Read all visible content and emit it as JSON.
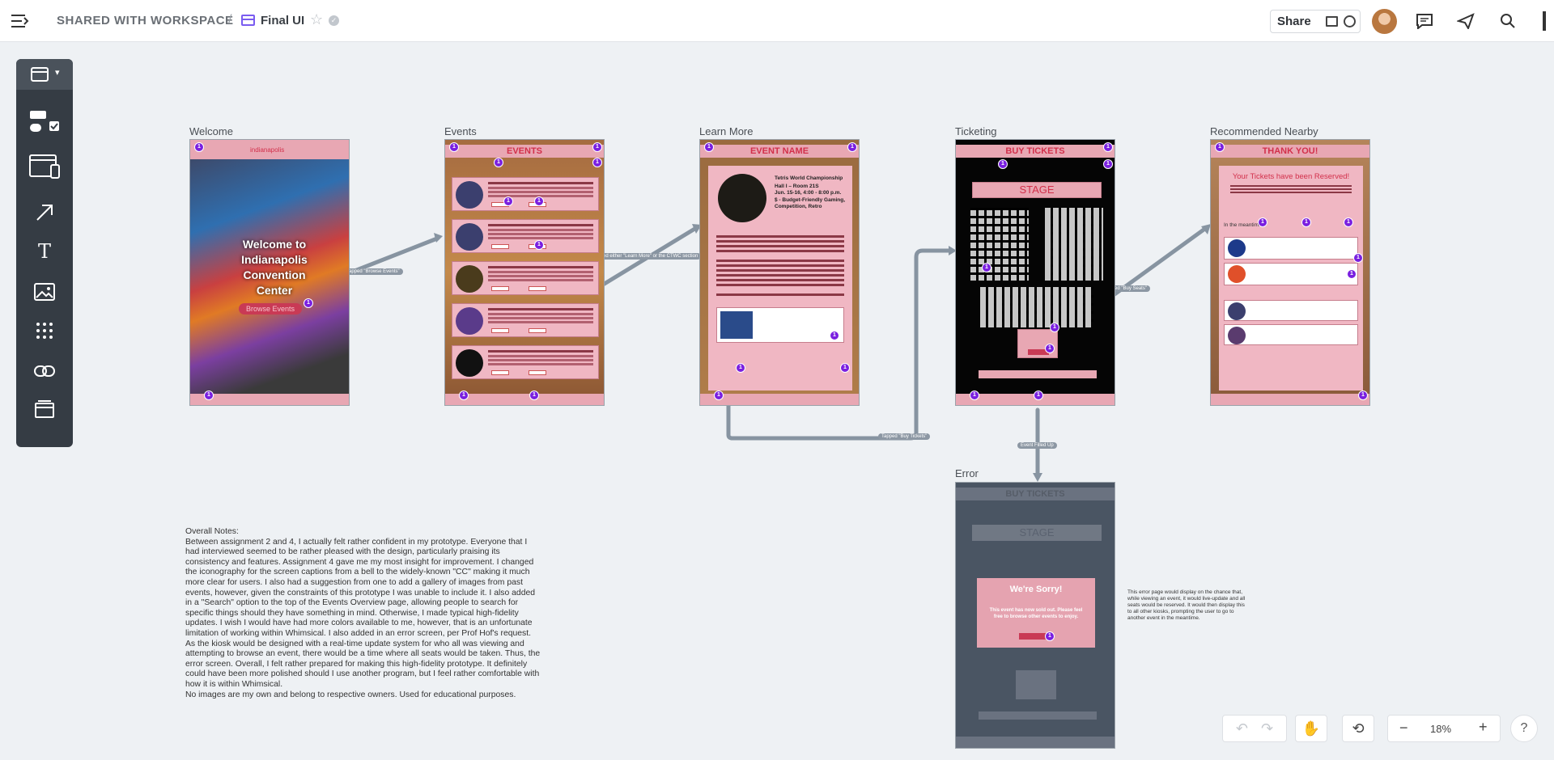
{
  "header": {
    "breadcrumb": "SHARED WITH WORKSPACE",
    "separator": "/",
    "doc_title": "Final UI",
    "share_label": "Share"
  },
  "frames": {
    "welcome": {
      "label": "Welcome",
      "logo": "indianapolis",
      "title": "Welcome to Indianapolis Convention Center",
      "button": "Browse Events"
    },
    "events": {
      "label": "Events",
      "header": "EVENTS"
    },
    "learn": {
      "label": "Learn More",
      "header": "EVENT NAME",
      "event_title": "Tetris World Championship",
      "event_meta": "Hall I – Room 21S",
      "event_time": "Jun. 15-16, 4:00 - 8:00 p.m.",
      "event_tags": "$ - Budget-Friendly Gaming, Competition, Retro"
    },
    "ticketing": {
      "label": "Ticketing",
      "header": "BUY TICKETS",
      "stage": "STAGE"
    },
    "recommended": {
      "label": "Recommended Nearby",
      "header": "THANK YOU!",
      "heading": "Your Tickets have been Reserved!",
      "meantime": "In the meantime..."
    },
    "error": {
      "label": "Error",
      "header": "BUY TICKETS",
      "stage": "STAGE",
      "dialog_title": "We're Sorry!",
      "dialog_text": "This event has now sold out. Please feel free to browse other events to enjoy."
    }
  },
  "connectors": {
    "c1": "Tapped \"Browse Events\"",
    "c2": "Tapped either \"Learn More\" or the CTWC section",
    "c3": "Tapped \"Buy Tickets\"",
    "c4": "Tapped \"Buy Seats\"",
    "c5": "Event Filled Up"
  },
  "notes": {
    "heading": "Overall Notes:",
    "body": "Between assignment 2 and 4, I actually felt rather confident in my prototype. Everyone that I had interviewed seemed to be rather pleased with the design, particularly praising its consistency and features. Assignment 4 gave me my most insight for improvement. I changed the iconography for the screen captions from a bell to the widely-known \"CC\" making it much more clear for users. I also had a suggestion from one to add a gallery of images from past events, however, given the constraints of this prototype I was unable to include it. I also added in a \"Search\" option to the top of the Events Overview page, allowing people to search for specific things should they have something in mind. Otherwise, I made typical high-fidelity updates. I wish I would have had more colors available to me, however, that is an unfortunate limitation of working within Whimsical. I also added in an error screen, per Prof Hof's request. As the kiosk would be designed with a real-time update system for who all was viewing and attempting to browse an event, there would be a time where all seats would be taken. Thus, the error screen. Overall, I felt rather prepared for making this high-fidelity prototype. It definitely could have been more polished should I use another program, but I feel rather comfortable with how it is within Whimsical.",
    "footer": "No images are my own and belong to respective owners. Used for educational purposes."
  },
  "error_note": "This error page would display on the chance that, while viewing an event, it would live-update and all seats would be reserved. It would then display this to all other kiosks, prompting the user to go to another event in the meantime.",
  "zoom": {
    "level": "18%",
    "minus": "−",
    "plus": "+"
  },
  "help": "?"
}
